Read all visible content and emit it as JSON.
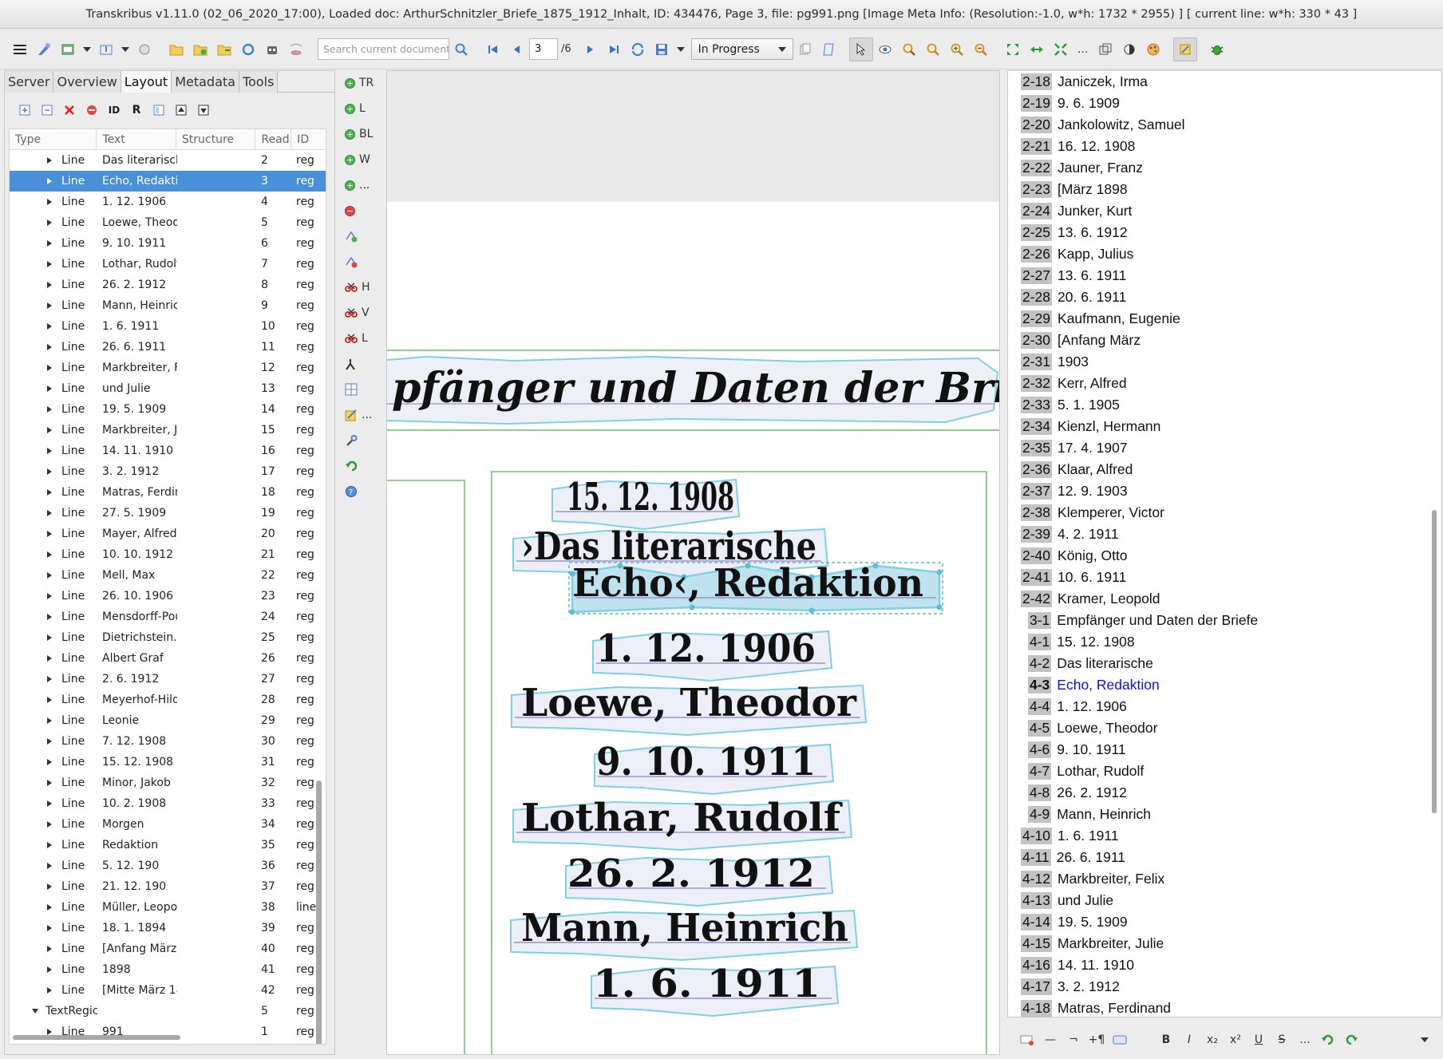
{
  "window": {
    "title": "Transkribus v1.11.0 (02_06_2020_17:00), Loaded doc: ArthurSchnitzler_Briefe_1875_1912_Inhalt, ID: 434476, Page 3, file: pg991.png [Image Meta Info: (Resolution:-1.0, w*h: 1732 * 2955) ] [ current line: w*h: 330 * 43 ]"
  },
  "toolbar": {
    "search_placeholder": "Search current document...",
    "page_current": "3",
    "page_total": "/6",
    "status": "In Progress",
    "more": "..."
  },
  "left_panel": {
    "tabs": [
      "Server",
      "Overview",
      "Layout",
      "Metadata",
      "Tools"
    ],
    "selected_tab": "Layout",
    "columns": [
      "Type",
      "Text",
      "Structure",
      "Read",
      "ID"
    ],
    "rows": [
      {
        "type": "Line",
        "text": "Das literarisch",
        "read": "2",
        "id": "reg"
      },
      {
        "type": "Line",
        "text": "Echo, Redaktic",
        "read": "3",
        "id": "reg",
        "selected": true
      },
      {
        "type": "Line",
        "text": "1. 12. 1906",
        "read": "4",
        "id": "reg"
      },
      {
        "type": "Line",
        "text": "Loewe, Theod",
        "read": "5",
        "id": "reg"
      },
      {
        "type": "Line",
        "text": "9. 10. 1911",
        "read": "6",
        "id": "reg"
      },
      {
        "type": "Line",
        "text": "Lothar, Rudolf",
        "read": "7",
        "id": "reg"
      },
      {
        "type": "Line",
        "text": "26. 2. 1912",
        "read": "8",
        "id": "reg"
      },
      {
        "type": "Line",
        "text": "Mann, Heinricl",
        "read": "9",
        "id": "reg"
      },
      {
        "type": "Line",
        "text": "1. 6. 1911",
        "read": "10",
        "id": "reg"
      },
      {
        "type": "Line",
        "text": "26. 6. 1911",
        "read": "11",
        "id": "reg"
      },
      {
        "type": "Line",
        "text": "Markbreiter, Fe",
        "read": "12",
        "id": "reg"
      },
      {
        "type": "Line",
        "text": "und Julie",
        "read": "13",
        "id": "reg"
      },
      {
        "type": "Line",
        "text": "19. 5. 1909",
        "read": "14",
        "id": "reg"
      },
      {
        "type": "Line",
        "text": "Markbreiter, Ju",
        "read": "15",
        "id": "reg"
      },
      {
        "type": "Line",
        "text": "14. 11. 1910",
        "read": "16",
        "id": "reg"
      },
      {
        "type": "Line",
        "text": "3. 2. 1912",
        "read": "17",
        "id": "reg"
      },
      {
        "type": "Line",
        "text": "Matras, Ferdin",
        "read": "18",
        "id": "reg"
      },
      {
        "type": "Line",
        "text": "27. 5. 1909",
        "read": "19",
        "id": "reg"
      },
      {
        "type": "Line",
        "text": "Mayer, Alfred",
        "read": "20",
        "id": "reg"
      },
      {
        "type": "Line",
        "text": "10. 10. 1912",
        "read": "21",
        "id": "reg"
      },
      {
        "type": "Line",
        "text": "Mell, Max",
        "read": "22",
        "id": "reg"
      },
      {
        "type": "Line",
        "text": "26. 10. 1906",
        "read": "23",
        "id": "reg"
      },
      {
        "type": "Line",
        "text": "Mensdorff-Pou",
        "read": "24",
        "id": "reg"
      },
      {
        "type": "Line",
        "text": "Dietrichstein.",
        "read": "25",
        "id": "reg"
      },
      {
        "type": "Line",
        "text": "Albert Graf",
        "read": "26",
        "id": "reg"
      },
      {
        "type": "Line",
        "text": "2. 6. 1912",
        "read": "27",
        "id": "reg"
      },
      {
        "type": "Line",
        "text": "Meyerhof-Hild",
        "read": "28",
        "id": "reg"
      },
      {
        "type": "Line",
        "text": "Leonie",
        "read": "29",
        "id": "reg"
      },
      {
        "type": "Line",
        "text": "7. 12. 1908",
        "read": "30",
        "id": "reg"
      },
      {
        "type": "Line",
        "text": "15. 12. 1908",
        "read": "31",
        "id": "reg"
      },
      {
        "type": "Line",
        "text": "Minor, Jakob",
        "read": "32",
        "id": "reg"
      },
      {
        "type": "Line",
        "text": "10. 2. 1908",
        "read": "33",
        "id": "reg"
      },
      {
        "type": "Line",
        "text": "Morgen",
        "read": "34",
        "id": "reg"
      },
      {
        "type": "Line",
        "text": "Redaktion",
        "read": "35",
        "id": "reg"
      },
      {
        "type": "Line",
        "text": "5. 12. 190",
        "read": "36",
        "id": "reg"
      },
      {
        "type": "Line",
        "text": "21. 12. 190",
        "read": "37",
        "id": "reg"
      },
      {
        "type": "Line",
        "text": "Müller, Leopol",
        "read": "38",
        "id": "line"
      },
      {
        "type": "Line",
        "text": "18. 1. 1894",
        "read": "39",
        "id": "reg"
      },
      {
        "type": "Line",
        "text": "[Anfang März",
        "read": "40",
        "id": "reg"
      },
      {
        "type": "Line",
        "text": "1898",
        "read": "41",
        "id": "reg"
      },
      {
        "type": "Line",
        "text": "[Mitte März 18",
        "read": "42",
        "id": "reg"
      },
      {
        "type": "TextRegic",
        "text": "",
        "read": "5",
        "id": "reg",
        "expanded": true
      },
      {
        "type": "Line",
        "text": "991",
        "read": "1",
        "id": "reg"
      }
    ]
  },
  "vtools": {
    "items": [
      {
        "icon": "add-icon",
        "label": "TR"
      },
      {
        "icon": "add-icon",
        "label": "L"
      },
      {
        "icon": "add-icon",
        "label": "BL"
      },
      {
        "icon": "add-icon",
        "label": "W"
      },
      {
        "icon": "add-icon",
        "label": "..."
      },
      {
        "icon": "remove-icon",
        "label": ""
      },
      {
        "icon": "add-point-icon",
        "label": ""
      },
      {
        "icon": "remove-point-icon",
        "label": ""
      },
      {
        "icon": "split-icon",
        "label": "H"
      },
      {
        "icon": "split-icon",
        "label": "V"
      },
      {
        "icon": "split-icon",
        "label": "L"
      },
      {
        "icon": "merge-icon",
        "label": ""
      },
      {
        "icon": "table-icon",
        "label": ""
      },
      {
        "icon": "edit-icon",
        "label": "..."
      },
      {
        "icon": "wrench-icon",
        "label": ""
      },
      {
        "icon": "undo-icon",
        "label": ""
      },
      {
        "icon": "help-icon",
        "label": ""
      }
    ]
  },
  "canvas": {
    "heading": "pfänger und Daten der Briefe",
    "lines": [
      "15. 12. 1908",
      "›Das literarische",
      "Echo‹, Redaktion",
      "1. 12. 1906",
      "Loewe, Theodor",
      "9. 10. 1911",
      "Lothar, Rudolf",
      "26.   2. 1912",
      "Mann, Heinrich",
      "1.   6. 1911"
    ]
  },
  "transcription": {
    "current": "4-3",
    "lines": [
      {
        "num": "2-18",
        "text": "Janiczek, Irma"
      },
      {
        "num": "2-19",
        "text": "9. 6. 1909"
      },
      {
        "num": "2-20",
        "text": "Jankolowitz, Samuel"
      },
      {
        "num": "2-21",
        "text": "16. 12. 1908"
      },
      {
        "num": "2-22",
        "text": "Jauner, Franz"
      },
      {
        "num": "2-23",
        "text": "[März 1898"
      },
      {
        "num": "2-24",
        "text": "Junker, Kurt"
      },
      {
        "num": "2-25",
        "text": "13. 6. 1912"
      },
      {
        "num": "2-26",
        "text": "Kapp, Julius"
      },
      {
        "num": "2-27",
        "text": "13. 6. 1911"
      },
      {
        "num": "2-28",
        "text": "20. 6. 1911"
      },
      {
        "num": "2-29",
        "text": "Kaufmann, Eugenie"
      },
      {
        "num": "2-30",
        "text": "[Anfang März"
      },
      {
        "num": "2-31",
        "text": "1903"
      },
      {
        "num": "2-32",
        "text": "Kerr, Alfred"
      },
      {
        "num": "2-33",
        "text": "5. 1. 1905"
      },
      {
        "num": "2-34",
        "text": "Kienzl, Hermann"
      },
      {
        "num": "2-35",
        "text": "17. 4. 1907"
      },
      {
        "num": "2-36",
        "text": "Klaar, Alfred"
      },
      {
        "num": "2-37",
        "text": "12. 9. 1903"
      },
      {
        "num": "2-38",
        "text": "Klemperer, Victor"
      },
      {
        "num": "2-39",
        "text": "4. 2. 1911"
      },
      {
        "num": "2-40",
        "text": "König, Otto"
      },
      {
        "num": "2-41",
        "text": "10. 6. 1911"
      },
      {
        "num": "2-42",
        "text": "Kramer, Leopold"
      },
      {
        "num": "3-1",
        "text": "Empfänger und Daten der Briefe"
      },
      {
        "num": "4-1",
        "text": "15. 12. 1908"
      },
      {
        "num": "4-2",
        "text": "Das literarische"
      },
      {
        "num": "4-3",
        "text": "Echo, Redaktion"
      },
      {
        "num": "4-4",
        "text": "1. 12. 1906"
      },
      {
        "num": "4-5",
        "text": "Loewe, Theodor"
      },
      {
        "num": "4-6",
        "text": "9. 10. 1911"
      },
      {
        "num": "4-7",
        "text": "Lothar, Rudolf"
      },
      {
        "num": "4-8",
        "text": "26. 2. 1912"
      },
      {
        "num": "4-9",
        "text": "Mann, Heinrich"
      },
      {
        "num": "4-10",
        "text": "1. 6. 1911"
      },
      {
        "num": "4-11",
        "text": "26. 6. 1911"
      },
      {
        "num": "4-12",
        "text": "Markbreiter, Felix"
      },
      {
        "num": "4-13",
        "text": "und Julie"
      },
      {
        "num": "4-14",
        "text": "19. 5. 1909"
      },
      {
        "num": "4-15",
        "text": "Markbreiter, Julie"
      },
      {
        "num": "4-16",
        "text": "14. 11. 1910"
      },
      {
        "num": "4-17",
        "text": "3. 2. 1912"
      },
      {
        "num": "4-18",
        "text": "Matras, Ferdinand"
      }
    ]
  },
  "bottom_toolbar": {
    "items": [
      "—",
      "¬",
      "+¶",
      "B",
      "I",
      "x₂",
      "x²",
      "U",
      "S",
      "..."
    ]
  },
  "colors": {
    "selection": "#4a90d9",
    "region_border": "#8fd08f",
    "line_polygon": "#7fd0e0",
    "current_text": "#1010d8"
  }
}
